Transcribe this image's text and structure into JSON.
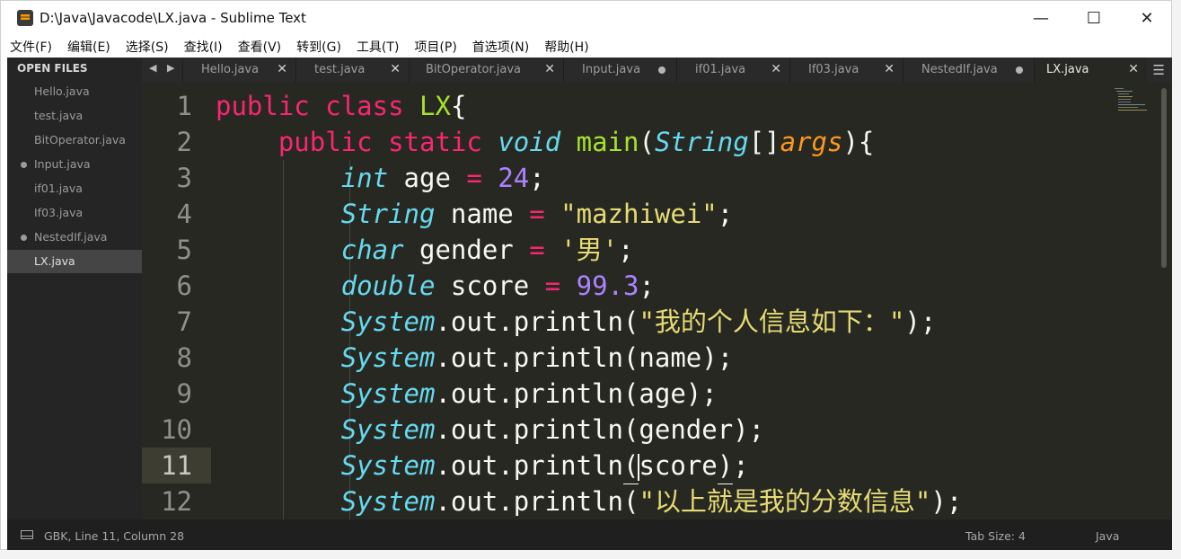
{
  "window": {
    "title": "D:\\Java\\Javacode\\LX.java - Sublime Text",
    "minimize_glyph": "—",
    "maximize_glyph": "☐",
    "close_glyph": "✕"
  },
  "menu": [
    "文件(F)",
    "编辑(E)",
    "选择(S)",
    "查找(I)",
    "查看(V)",
    "转到(G)",
    "工具(T)",
    "项目(P)",
    "首选项(N)",
    "帮助(H)"
  ],
  "sidebar": {
    "header": "OPEN FILES",
    "items": [
      {
        "label": "Hello.java",
        "dirty": false,
        "active": false
      },
      {
        "label": "test.java",
        "dirty": false,
        "active": false
      },
      {
        "label": "BitOperator.java",
        "dirty": false,
        "active": false
      },
      {
        "label": "Input.java",
        "dirty": true,
        "active": false
      },
      {
        "label": "if01.java",
        "dirty": false,
        "active": false
      },
      {
        "label": "If03.java",
        "dirty": false,
        "active": false
      },
      {
        "label": "NestedIf.java",
        "dirty": true,
        "active": false
      },
      {
        "label": "LX.java",
        "dirty": false,
        "active": true
      }
    ]
  },
  "tabs": {
    "nav": "◀ ▶",
    "menu_glyph": "☰",
    "items": [
      {
        "label": "Hello.java",
        "dirty": false,
        "active": false
      },
      {
        "label": "test.java",
        "dirty": false,
        "active": false
      },
      {
        "label": "BitOperator.java",
        "dirty": false,
        "active": false
      },
      {
        "label": "Input.java",
        "dirty": true,
        "active": false
      },
      {
        "label": "if01.java",
        "dirty": false,
        "active": false
      },
      {
        "label": "If03.java",
        "dirty": false,
        "active": false
      },
      {
        "label": "NestedIf.java",
        "dirty": true,
        "active": false
      },
      {
        "label": "LX.java",
        "dirty": false,
        "active": true
      }
    ],
    "close_glyph": "✕"
  },
  "editor": {
    "line_numbers": [
      "1",
      "2",
      "3",
      "4",
      "5",
      "6",
      "7",
      "8",
      "9",
      "10",
      "11",
      "12"
    ],
    "current_line": "11",
    "code": {
      "l1": {
        "kw1": "public",
        "kw2": "class",
        "cls": "LX",
        "brace": "{"
      },
      "l2": {
        "kw1": "public",
        "kw2": "static",
        "ty": "void",
        "fn": "main",
        "open": "(",
        "pt": "String",
        "arr": "[]",
        "pa": "args",
        "close": "){"
      },
      "l3": {
        "ty": "int",
        "name": " age ",
        "op": "=",
        "val": "24",
        "end": ";"
      },
      "l4": {
        "ty": "String",
        "name": " name ",
        "op": "=",
        "val": "\"mazhiwei\"",
        "end": ";"
      },
      "l5": {
        "ty": "char",
        "name": " gender ",
        "op": "=",
        "val": "'男'",
        "end": ";"
      },
      "l6": {
        "ty": "double",
        "name": " score ",
        "op": "=",
        "val": "99.3",
        "end": ";"
      },
      "l7": {
        "obj": "System",
        "rest": ".out.println(",
        "arg": "\"我的个人信息如下：\"",
        "end": ");"
      },
      "l8": {
        "obj": "System",
        "rest": ".out.println(name);"
      },
      "l9": {
        "obj": "System",
        "rest": ".out.println(age);"
      },
      "l10": {
        "obj": "System",
        "rest": ".out.println(gender);"
      },
      "l11": {
        "obj": "System",
        "pre": ".out.println",
        "open": "(",
        "arg": "score",
        "close": ")",
        "end": ";"
      },
      "l12": {
        "obj": "System",
        "rest": ".out.println(",
        "arg": "\"以上就是我的分数信息\"",
        "end": ");"
      }
    }
  },
  "status": {
    "position": "GBK, Line 11, Column 28",
    "tab_size": "Tab Size: 4",
    "syntax": "Java"
  },
  "colors": {
    "keyword": "#f92672",
    "type": "#66d9ef",
    "function": "#a6e22e",
    "string": "#e6db74",
    "number": "#ae81ff",
    "parameter": "#fd971f",
    "background": "#272822"
  }
}
